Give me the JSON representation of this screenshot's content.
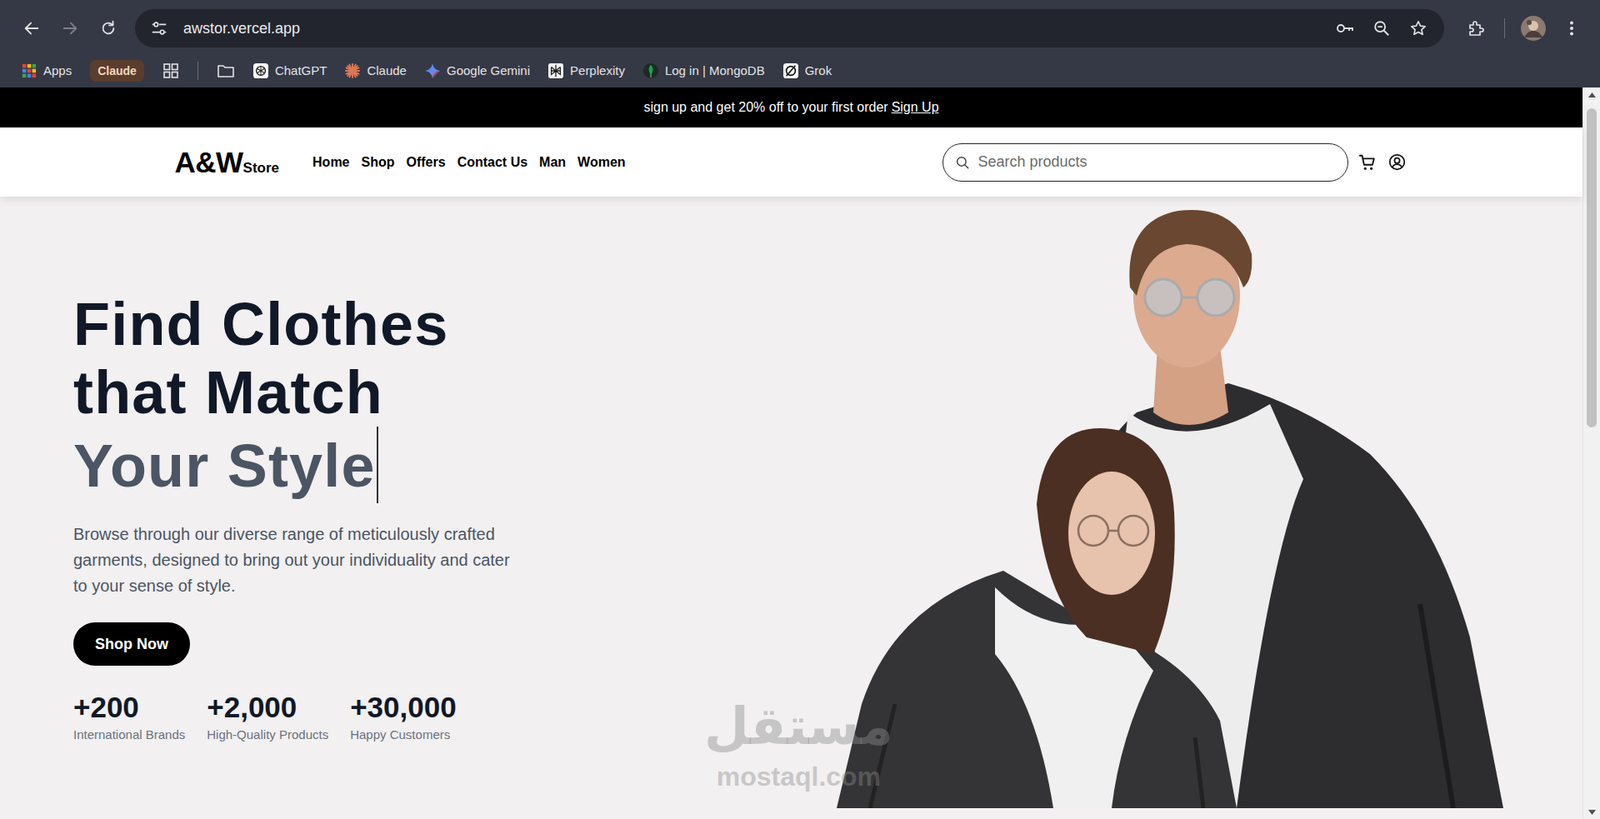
{
  "browser": {
    "url": "awstor.vercel.app",
    "bookmarks": [
      {
        "label": "Apps",
        "kind": "apps"
      },
      {
        "label": "Claude",
        "kind": "chip"
      },
      {
        "label": "ChatGPT",
        "kind": "chatgpt"
      },
      {
        "label": "Claude",
        "kind": "claude"
      },
      {
        "label": "Google Gemini",
        "kind": "gemini"
      },
      {
        "label": "Perplexity",
        "kind": "perplexity"
      },
      {
        "label": "Log in | MongoDB",
        "kind": "mongodb"
      },
      {
        "label": "Grok",
        "kind": "grok"
      }
    ]
  },
  "announcement": {
    "text": "sign up and get 20% off to your first order",
    "link": "Sign Up"
  },
  "header": {
    "logo_main": "A&W",
    "logo_sub": "Store",
    "nav": [
      {
        "label": "Home"
      },
      {
        "label": "Shop"
      },
      {
        "label": "Offers"
      },
      {
        "label": "Contact Us"
      },
      {
        "label": "Man"
      },
      {
        "label": "Women"
      }
    ],
    "search": {
      "placeholder": "Search products"
    }
  },
  "hero": {
    "title_lines": [
      "Find Clothes",
      "that Match"
    ],
    "title_accent": "Your Style",
    "typing_caret": true,
    "description": "Browse through our diverse range of meticulously crafted garments, designed to bring out your individuality and cater to your sense of style.",
    "button": "Shop Now",
    "stats": [
      {
        "value": "+200",
        "label": "International Brands"
      },
      {
        "value": "+2,000",
        "label": "High-Quality Products"
      },
      {
        "value": "+30,000",
        "label": "Happy Customers"
      }
    ]
  },
  "watermark": {
    "arabic": "مستقل",
    "latin": "mostaql.com"
  }
}
